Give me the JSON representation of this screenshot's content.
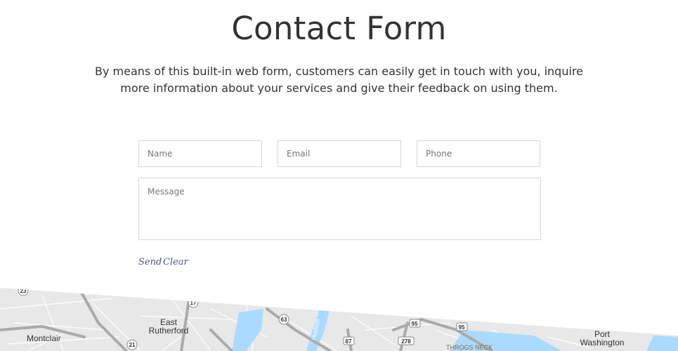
{
  "header": {
    "title": "Contact Form",
    "intro": "By means of this built-in web form, customers can easily get in touch with you, inquire more information about your services and give their feedback on using them."
  },
  "form": {
    "name_placeholder": "Name",
    "email_placeholder": "Email",
    "phone_placeholder": "Phone",
    "message_placeholder": "Message",
    "send_label": "Send",
    "clear_label": "Clear"
  },
  "map": {
    "places": [
      "Montclair",
      "East Rutherford",
      "Port Washington",
      "THROGS NECK"
    ],
    "place_lines": {
      "east_rutherford": [
        "East",
        "Rutherford"
      ],
      "port_washington": [
        "Port",
        "Washington"
      ]
    },
    "river": "Hudson",
    "highways": [
      "23",
      "17",
      "63",
      "95",
      "95",
      "21",
      "87",
      "278"
    ],
    "colors": {
      "land": "#e8e8e8",
      "road": "#aaaaaa",
      "water": "#aadaff"
    }
  }
}
